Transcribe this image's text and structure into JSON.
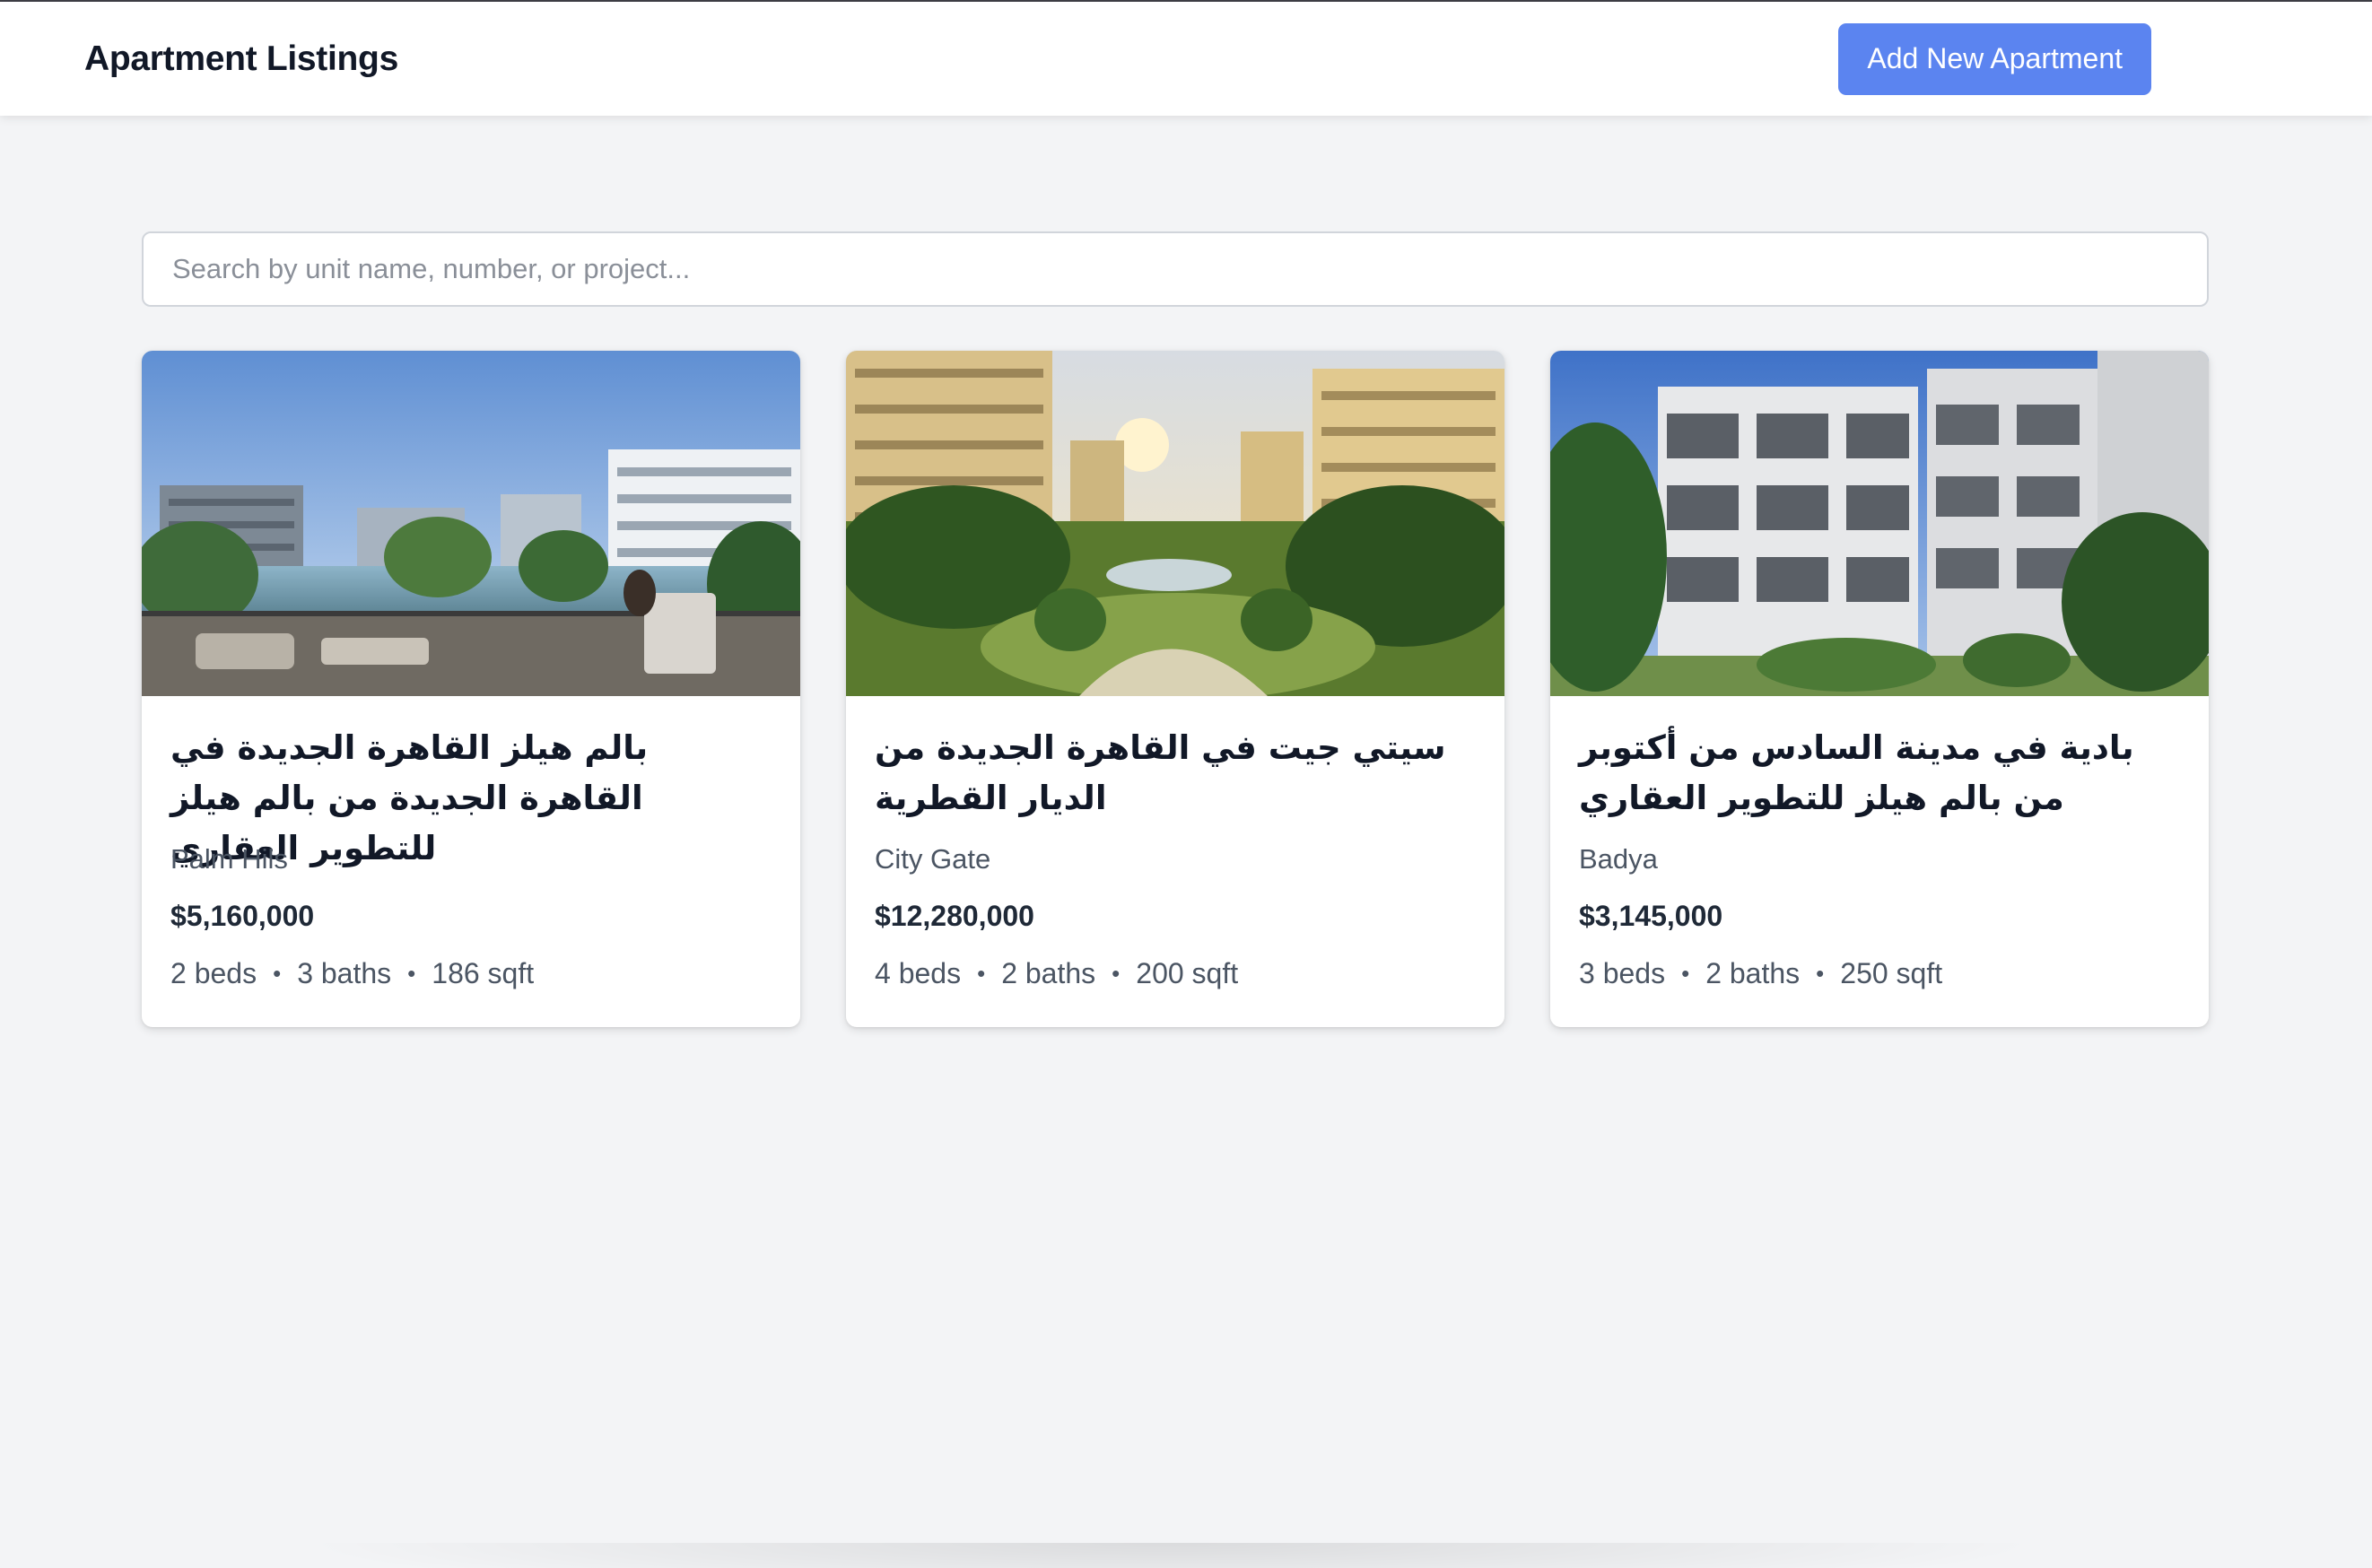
{
  "header": {
    "title": "Apartment Listings",
    "add_button_label": "Add New Apartment"
  },
  "search": {
    "value": "",
    "placeholder": "Search by unit name, number, or project..."
  },
  "listings": [
    {
      "title": "بالم هيلز القاهرة الجديدة في القاهرة الجديدة من بالم هيلز للتطوير العقاري",
      "project": "Palm Hils",
      "price": "$5,160,000",
      "beds": "2 beds",
      "baths": "3 baths",
      "area": "186 sqft",
      "image": "photo-balcony-lagoon"
    },
    {
      "title": "سيتي جيت في القاهرة الجديدة من الديار القطرية",
      "project": "City Gate",
      "price": "$12,280,000",
      "beds": "4 beds",
      "baths": "2 baths",
      "area": "200 sqft",
      "image": "photo-garden-sunset"
    },
    {
      "title": "بادية في مدينة السادس من أكتوبر من بالم هيلز للتطوير العقاري",
      "project": "Badya",
      "price": "$3,145,000",
      "beds": "3 beds",
      "baths": "2 baths",
      "area": "250 sqft",
      "image": "photo-white-buildings"
    }
  ],
  "colors": {
    "accent": "#5b84f0",
    "background": "#f3f4f6",
    "card": "#ffffff"
  }
}
